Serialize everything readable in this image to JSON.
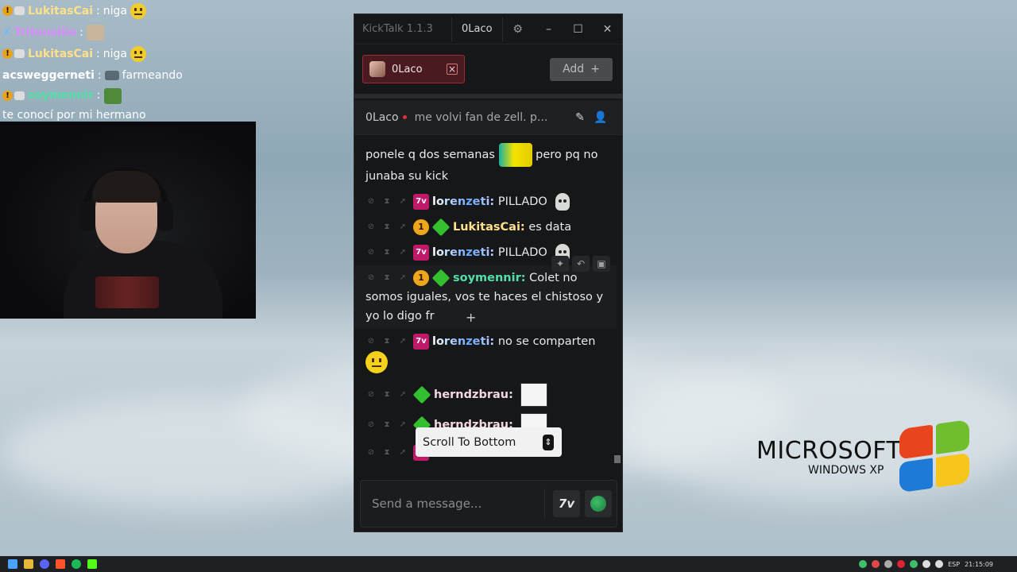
{
  "stream_chat": [
    {
      "user": "LukitasCai",
      "color": "#ffe08a",
      "text": "niga",
      "emote": "face"
    },
    {
      "user": "Tritonsillo",
      "color": "#d88cff",
      "text": "",
      "emote": "image"
    },
    {
      "user": "LukitasCai",
      "color": "#ffe08a",
      "text": "niga",
      "emote": "face"
    },
    {
      "user": "acsweggerneti",
      "color": "#ffffff",
      "text": "farmeando",
      "emote": "pre"
    },
    {
      "user": "soymennir",
      "color": "#52e0a8",
      "text": "te conocí por mi hermano",
      "emote": "pre"
    }
  ],
  "kicktalk": {
    "app_title": "KickTalk 1.1.3",
    "active_channel": "0Laco",
    "tab": {
      "name": "0Laco",
      "close": "×"
    },
    "add_label": "Add",
    "add_icon": "+",
    "header": {
      "channel": "0Laco",
      "title": "me volvi fan de zell. p..."
    },
    "messages": {
      "m0": "ponele q dos semanas",
      "m0b": "pero pq no junaba su kick",
      "m1_user": "lorenzeti:",
      "m1_text": "PILLADO",
      "m2_user": "LukitasCai:",
      "m2_text": "es data",
      "m3_user": "lorenzeti:",
      "m3_text": "PILLADO",
      "m4_user": "soymennir:",
      "m4_text": "Colet no somos iguales, vos te haces el chistoso y yo lo digo fr",
      "m5_user": "lorenzeti:",
      "m5_text": "no se comparten",
      "m6_user": "herndzbrau:",
      "m7_user": "herndzbrau:",
      "m8_user": "lorenzeti:"
    },
    "scroll_to_bottom": "Scroll To Bottom",
    "input_placeholder": "Send a message...",
    "badge_7tv": "7v",
    "badge_sub": "1"
  },
  "xp_logo": {
    "brand": "MICROSOFT",
    "product": "WINDOWS XP"
  },
  "taskbar": {
    "lang": "ESP",
    "time": "21:15:09"
  }
}
